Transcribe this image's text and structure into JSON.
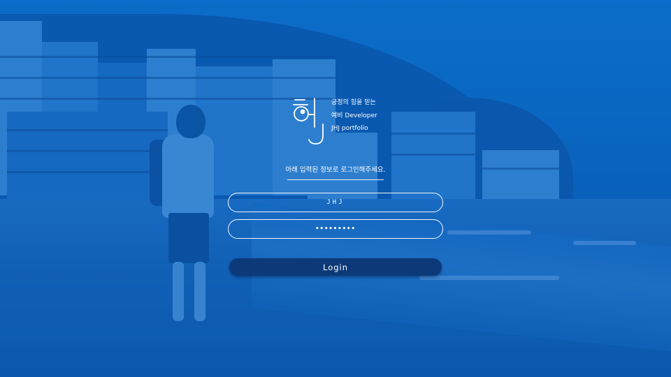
{
  "logo": {
    "icon": "hj-logo-icon",
    "tagline": [
      "긍정의 힘을 믿는",
      "예비 Developer",
      "JHJ portfolio"
    ]
  },
  "login": {
    "instruction": "아래 입력된 정보로 로그인해주세요.",
    "username_value": "JHJ",
    "password_value": "•••••••••",
    "submit_label": "Login"
  },
  "colors": {
    "overlay": "#0a5fb5",
    "button": "#0c3a78",
    "text": "#ffffff"
  }
}
